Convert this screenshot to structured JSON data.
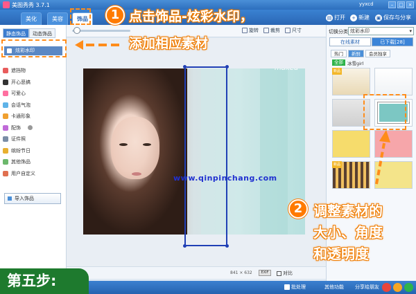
{
  "window": {
    "app_title": "美图秀秀 3.7.1",
    "user": "yyxcd"
  },
  "tabs": [
    {
      "label": "美化"
    },
    {
      "label": "美容"
    },
    {
      "label": "饰品",
      "active": true
    }
  ],
  "top_actions": {
    "open": "打开",
    "new": "新建",
    "save_share": "保存与分享"
  },
  "toolbar": {
    "rotate": "旋转",
    "crop": "裁剪",
    "size": "尺寸"
  },
  "left_panel": {
    "subtabs": [
      "静态饰品",
      "动态饰品"
    ],
    "active_category": "炫彩水印",
    "categories": [
      "遮挡物",
      "开心恶搞",
      "可爱心",
      "会话气泡",
      "卡通形象",
      "配饰",
      "证件照",
      "缤纷节日",
      "其他饰品",
      "用户自定义"
    ],
    "import_label": "导入饰品"
  },
  "canvas": {
    "watermark_url": "www.qinpinchang.com",
    "brand_text": "makeu",
    "image_size": "841 × 632",
    "exif_label": "EXIF",
    "compare_label": "对比"
  },
  "right_panel": {
    "switch_label": "切换分类",
    "selected_category": "炫彩水印",
    "tabs": {
      "online": "在线素材",
      "downloaded": "已下载[28]"
    },
    "subtabs": [
      "热门",
      "新鲜",
      "会员独享"
    ],
    "filter_all": "全部",
    "filter_author": "冰雪girl",
    "new_label": "新品"
  },
  "annotations": {
    "step1_number": "1",
    "step1_line1": "点击饰品-炫彩水印，",
    "step1_line2": "添加相应素材",
    "step2_number": "2",
    "step2_line1": "调整素材的",
    "step2_line2": "大小、角度",
    "step2_line3": "和透明度",
    "step_badge": "第五步:"
  },
  "bottom_bar": {
    "batch": "批处理",
    "item2": "其他功能",
    "item3": "分享给朋友"
  },
  "colors": {
    "accent_orange": "#ff7a00",
    "titlebar_blue": "#2d6fbd",
    "selection_blue": "#1f3fb5",
    "step_green": "#1e7a2e"
  }
}
